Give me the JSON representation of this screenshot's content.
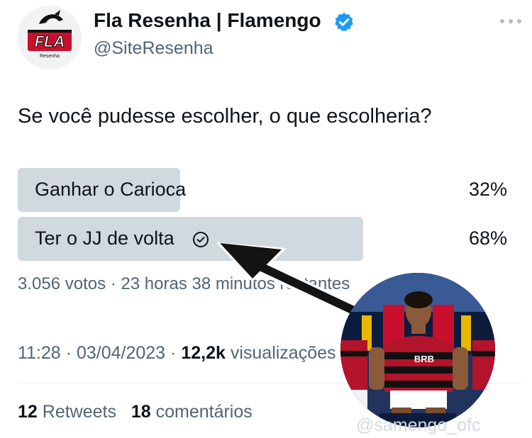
{
  "header": {
    "avatar_text": "FLA",
    "avatar_subtext": "Resenha",
    "display_name": "Fla Resenha | Flamengo",
    "handle": "@SiteResenha"
  },
  "tweet": {
    "text": "Se você pudesse escolher, o que escolheria?"
  },
  "poll": {
    "options": [
      {
        "label": "Ganhar o Carioca",
        "percent_text": "32%",
        "percent": 32,
        "winner": false
      },
      {
        "label": "Ter o JJ de volta",
        "percent_text": "68%",
        "percent": 68,
        "winner": true
      }
    ],
    "meta": "3.056 votos · 23 horas 38 minutos restantes"
  },
  "meta": {
    "time": "11:28",
    "date": "03/04/2023",
    "views_count": "12,2k",
    "views_label": "visualizações"
  },
  "stats": {
    "retweets_count": "12",
    "retweets_label": "Retweets",
    "comments_count": "18",
    "comments_label": "comentários"
  },
  "overlay": {
    "jersey_sponsor": "BRB",
    "watermark": "@samengo_ofc"
  },
  "colors": {
    "verified": "#1d9bf0",
    "poll_bar": "#cfd9de",
    "secondary_text": "#536471",
    "flamengo_red": "#c8102e"
  },
  "icons": {
    "verified": "verified-badge-icon",
    "more": "more-horizontal-icon",
    "winner": "check-circle-icon"
  }
}
